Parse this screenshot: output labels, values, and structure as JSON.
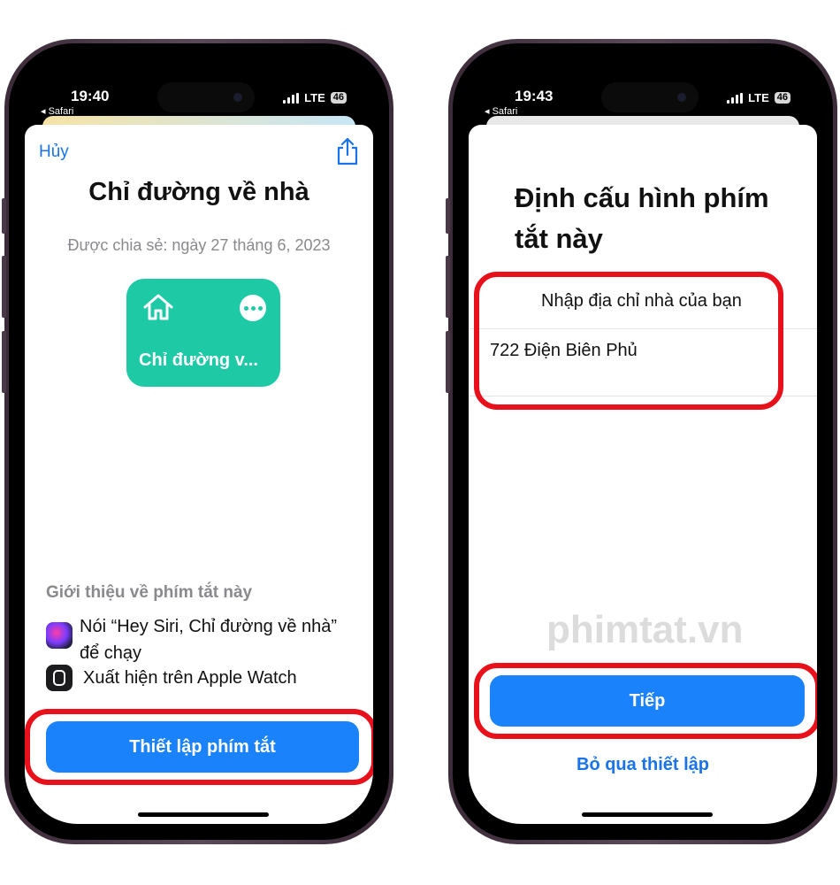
{
  "left_phone": {
    "status": {
      "time": "19:40",
      "back_app": "◂ Safari",
      "network": "LTE",
      "battery": "46"
    },
    "sheet_gradient": [
      "#f6e3a6",
      "#c7e6f7"
    ],
    "cancel_label": "Hủy",
    "title": "Chỉ đường về nhà",
    "shared_date": "Được chia sẻ: ngày 27 tháng 6, 2023",
    "card": {
      "label": "Chỉ đường v...",
      "color": "#1ec9a6",
      "icon": "house-icon"
    },
    "about": {
      "heading": "Giới thiệu về phím tắt này",
      "siri_text": "Nói “Hey Siri, Chỉ đường về nhà” để chạy",
      "watch_text": "Xuất hiện trên Apple Watch"
    },
    "setup_button": "Thiết lập phím tắt"
  },
  "right_phone": {
    "status": {
      "time": "19:43",
      "back_app": "◂ Safari",
      "network": "LTE",
      "battery": "46"
    },
    "sheet_gradient": [
      "#e8e8e8",
      "#e8e8e8"
    ],
    "title": "Định cấu hình phím tắt này",
    "field_label": "Nhập địa chỉ nhà của bạn",
    "address_value": "722 Điện Biên Phủ",
    "watermark": "phimtat.vn",
    "next_button": "Tiếp",
    "skip_link": "Bỏ qua thiết lập"
  },
  "colors": {
    "accent": "#1a82fb",
    "highlight": "#e8101a"
  }
}
